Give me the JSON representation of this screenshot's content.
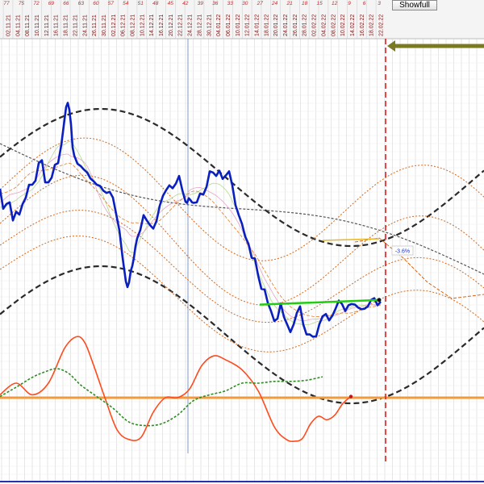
{
  "toolbar": {
    "showfull_label": "Showfull"
  },
  "colors": {
    "price": "#0a1fbf",
    "channel_orange": "#d2691e",
    "channel_black": "#333333",
    "grid": "#d6d6d6",
    "marker": "#e81c1c",
    "hline": "#f39a3c",
    "osc_fast": "#ff4a1c",
    "osc_slow": "#2e8b22",
    "trend": "#22cc11",
    "arrow": "#7a7a22"
  },
  "chart_data": [
    {
      "type": "line",
      "title": "",
      "x_tick_labels": [
        "02.11.21",
        "04.11.21",
        "08.11.21",
        "10.11.21",
        "12.11.21",
        "16.11.21",
        "18.11.21",
        "22.11.21",
        "24.11.21",
        "26.11.21",
        "30.11.21",
        "02.12.21",
        "06.12.21",
        "08.12.21",
        "10.12.21",
        "14.12.21",
        "16.12.21",
        "20.12.21",
        "22.12.21",
        "24.12.21",
        "28.12.21",
        "30.12.21",
        "04.01.22",
        "06.01.22",
        "10.01.22",
        "12.01.22",
        "14.01.22",
        "18.01.22",
        "20.01.22",
        "24.01.22",
        "26.01.22",
        "28.01.22",
        "02.02.22",
        "04.02.22",
        "08.02.22",
        "10.02.22",
        "14.02.22",
        "16.02.22",
        "18.02.22",
        "22.02.22"
      ],
      "countdown_labels": [
        "77",
        "75",
        "72",
        "69",
        "66",
        "63",
        "60",
        "57",
        "54",
        "51",
        "48",
        "45",
        "42",
        "39",
        "36",
        "33",
        "30",
        "27",
        "24",
        "21",
        "18",
        "15",
        "12",
        "9",
        "6",
        "3"
      ],
      "annotation": "-3.6%",
      "grid": true,
      "series": [
        {
          "role": "price",
          "x": [
            0,
            4,
            8,
            12,
            16,
            20,
            24,
            28,
            32,
            36,
            40,
            44,
            48,
            52,
            56,
            60,
            64,
            68,
            72,
            76,
            80,
            82,
            84,
            86,
            88,
            90,
            92,
            96,
            100,
            104,
            108,
            112,
            116,
            120,
            124,
            128,
            132,
            136,
            140,
            144,
            148,
            152,
            156,
            158,
            160,
            162,
            164,
            166,
            168,
            170,
            174,
            178,
            182,
            186,
            190,
            194,
            198,
            202,
            206,
            210,
            214,
            218,
            222,
            226,
            230,
            232,
            234,
            236,
            238,
            240,
            244,
            248,
            252,
            256,
            260,
            264,
            268,
            272,
            276,
            280,
            284,
            288,
            292,
            296,
            300,
            304,
            308,
            312,
            316,
            320,
            324,
            328,
            332,
            336,
            340,
            344,
            348,
            352,
            356,
            360,
            364,
            368,
            372,
            376,
            380,
            384,
            388,
            392,
            396,
            400,
            404,
            408,
            412,
            416,
            420,
            424,
            428,
            432,
            436,
            440,
            444,
            448,
            452,
            456,
            460,
            464,
            468,
            472
          ],
          "y": [
            0.84,
            0.5,
            0.58,
            0.61,
            0.3,
            0.45,
            0.4,
            0.58,
            0.69,
            0.91,
            0.91,
            0.98,
            1.28,
            1.33,
            0.95,
            0.95,
            1.03,
            1.25,
            1.28,
            1.59,
            2.03,
            2.24,
            2.31,
            2.19,
            1.94,
            1.55,
            1.41,
            1.27,
            1.23,
            1.17,
            1.12,
            1.02,
            0.97,
            0.91,
            0.89,
            0.81,
            0.77,
            0.79,
            0.69,
            0.41,
            0.13,
            -0.34,
            -0.74,
            -0.84,
            -0.76,
            -0.57,
            -0.48,
            -0.34,
            -0.14,
            -0.01,
            0.14,
            0.39,
            0.3,
            0.22,
            0.16,
            0.29,
            0.55,
            0.72,
            0.82,
            0.9,
            0.85,
            0.93,
            1.06,
            0.82,
            0.62,
            0.6,
            0.68,
            0.65,
            0.61,
            0.6,
            0.61,
            0.76,
            0.74,
            0.87,
            1.14,
            1.12,
            1.06,
            1.15,
            1.01,
            1.07,
            1.14,
            0.9,
            0.56,
            0.39,
            0.24,
            0.02,
            -0.1,
            -0.34,
            -0.35,
            -0.64,
            -0.87,
            -0.88,
            -1.11,
            -1.25,
            -1.42,
            -1.38,
            -1.12,
            -1.35,
            -1.48,
            -1.61,
            -1.48,
            -1.28,
            -1.17,
            -1.48,
            -1.65,
            -1.65,
            -1.69,
            -1.68,
            -1.47,
            -1.34,
            -1.3,
            -1.41,
            -1.33,
            -1.21,
            -1.07,
            -1.13,
            -1.25,
            -1.15,
            -1.13,
            -1.14,
            -1.19,
            -1.22,
            -1.21,
            -1.17,
            -1.06,
            -1.03,
            -1.15,
            -1.09
          ]
        },
        {
          "role": "channel_mid",
          "x": [
            0,
            470
          ],
          "y": [
            0.8,
            -1.3
          ]
        },
        {
          "role": "trend",
          "x": [
            322,
            470
          ],
          "y": [
            -1.14,
            -1.06
          ]
        }
      ]
    },
    {
      "type": "line",
      "title": "",
      "level": 0,
      "series": [
        {
          "role": "oscillator_fast",
          "x": [
            0,
            20,
            40,
            60,
            80,
            95,
            105,
            115,
            130,
            145,
            160,
            175,
            190,
            205,
            220,
            235,
            250,
            265,
            280,
            300,
            320,
            340,
            355,
            365,
            375,
            385,
            395,
            405,
            415,
            425,
            435
          ],
          "y": [
            0.05,
            0.25,
            0.05,
            0.25,
            0.85,
            1.05,
            0.95,
            0.6,
            0,
            -0.55,
            -0.72,
            -0.68,
            -0.25,
            0,
            0,
            0.15,
            0.55,
            0.72,
            0.65,
            0.48,
            0.12,
            -0.5,
            -0.72,
            -0.75,
            -0.7,
            -0.45,
            -0.32,
            -0.38,
            -0.3,
            -0.1,
            0.02
          ]
        },
        {
          "role": "oscillator_slow",
          "x": [
            0,
            20,
            40,
            55,
            70,
            85,
            100,
            120,
            140,
            160,
            180,
            200,
            220,
            240,
            260,
            280,
            300,
            320,
            340,
            360,
            380,
            400
          ],
          "y": [
            0.02,
            0.18,
            0.35,
            0.44,
            0.5,
            0.42,
            0.22,
            0.02,
            -0.18,
            -0.42,
            -0.48,
            -0.45,
            -0.3,
            -0.05,
            0.05,
            0.12,
            0.25,
            0.25,
            0.28,
            0.28,
            0.3,
            0.36
          ]
        }
      ]
    }
  ]
}
